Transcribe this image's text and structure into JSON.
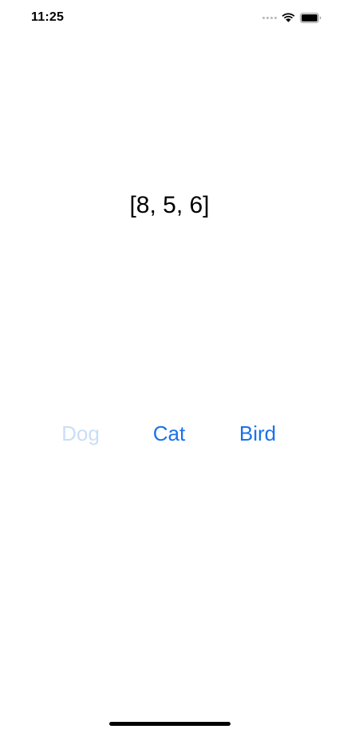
{
  "status_bar": {
    "time": "11:25",
    "signal_icon": "cellular-signal-icon",
    "wifi_icon": "wifi-icon",
    "battery_icon": "battery-icon"
  },
  "main": {
    "value_text": "[8, 5, 6]"
  },
  "buttons": [
    {
      "label": "Dog",
      "state": "disabled",
      "color": "#c9def8"
    },
    {
      "label": "Cat",
      "state": "enabled",
      "color": "#1a73e8"
    },
    {
      "label": "Bird",
      "state": "enabled",
      "color": "#1a73e8"
    }
  ],
  "colors": {
    "accent": "#1a73e8",
    "accent_dimmed": "#c9def8",
    "background": "#ffffff",
    "text": "#000000"
  }
}
